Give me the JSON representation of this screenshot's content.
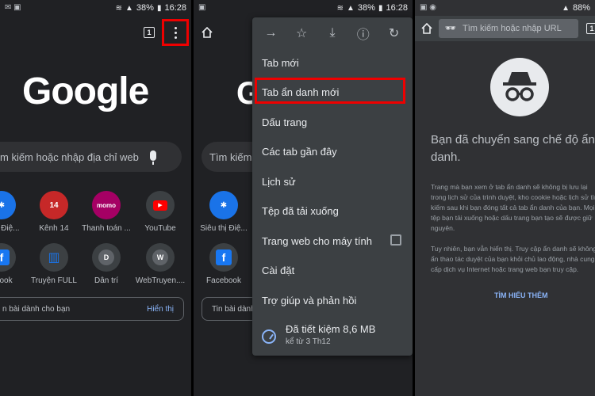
{
  "status_bar": {
    "battery_p1": "38%",
    "time_p1": "16:28",
    "battery_p2": "38%",
    "time_p2": "16:28",
    "battery_p3": "88%"
  },
  "home": {
    "tab_count": "1",
    "logo": "Google",
    "search_placeholder": "m kiếm hoặc nhập địa chỉ web",
    "shortcuts": [
      {
        "label": "u thị Điệ...",
        "icon": "running-person-icon"
      },
      {
        "label": "Kênh 14",
        "icon": "kenh14-icon",
        "badge": "14"
      },
      {
        "label": "Thanh toán ...",
        "icon": "momo-icon",
        "badge": "momo"
      },
      {
        "label": "YouTube",
        "icon": "youtube-icon"
      },
      {
        "label": "ebook",
        "icon": "facebook-icon",
        "badge": "f"
      },
      {
        "label": "Truyện FULL",
        "icon": "book-icon"
      },
      {
        "label": "Dân trí",
        "icon": "letter-d-icon",
        "badge": "D"
      },
      {
        "label": "WebTruyen....",
        "icon": "letter-w-icon",
        "badge": "W"
      }
    ],
    "feed_label": "n bài dành cho bạn",
    "feed_link": "Hiển thị"
  },
  "menu_screen": {
    "search_placeholder": "Tìm kiếm",
    "shortcuts": [
      {
        "label": "Siêu thị Điệ..."
      },
      {
        "label": "Facebook",
        "badge": "f"
      }
    ],
    "feed_label": "Tin bài dành",
    "menu_items": [
      "Tab mới",
      "Tab ẩn danh mới",
      "Dấu trang",
      "Các tab gần đây",
      "Lịch sử",
      "Tệp đã tải xuống",
      "Trang web cho máy tính",
      "Cài đặt",
      "Trợ giúp và phản hồi"
    ],
    "savings_title": "Đã tiết kiệm 8,6 MB",
    "savings_sub": "kể từ 3 Th12"
  },
  "incognito": {
    "url_placeholder": "Tìm kiếm hoặc nhập URL",
    "tab_count": "1",
    "title": "Bạn đã chuyển sang chế độ ẩn danh.",
    "para1": "Trang mà bạn xem ở tab ẩn danh sẽ không bị lưu lại trong lịch sử của trình duyệt, kho cookie hoặc lịch sử tìm kiếm sau khi bạn đóng tất cả tab ẩn danh của bạn. Mọi tệp bạn tải xuống hoặc dấu trang bạn tạo sẽ được giữ nguyên.",
    "para2": "Tuy nhiên, bạn vẫn hiển thị. Truy cập ẩn danh sẽ không ẩn thao tác duyệt của bạn khỏi chủ lao động, nhà cung cấp dịch vụ Internet hoặc trang web bạn truy cập.",
    "learn_more": "TÌM HIỂU THÊM"
  },
  "colors": {
    "highlight_border": "#e00000",
    "link": "#8ab4f8",
    "background": "#202124",
    "menu_bg": "#3c4043"
  }
}
